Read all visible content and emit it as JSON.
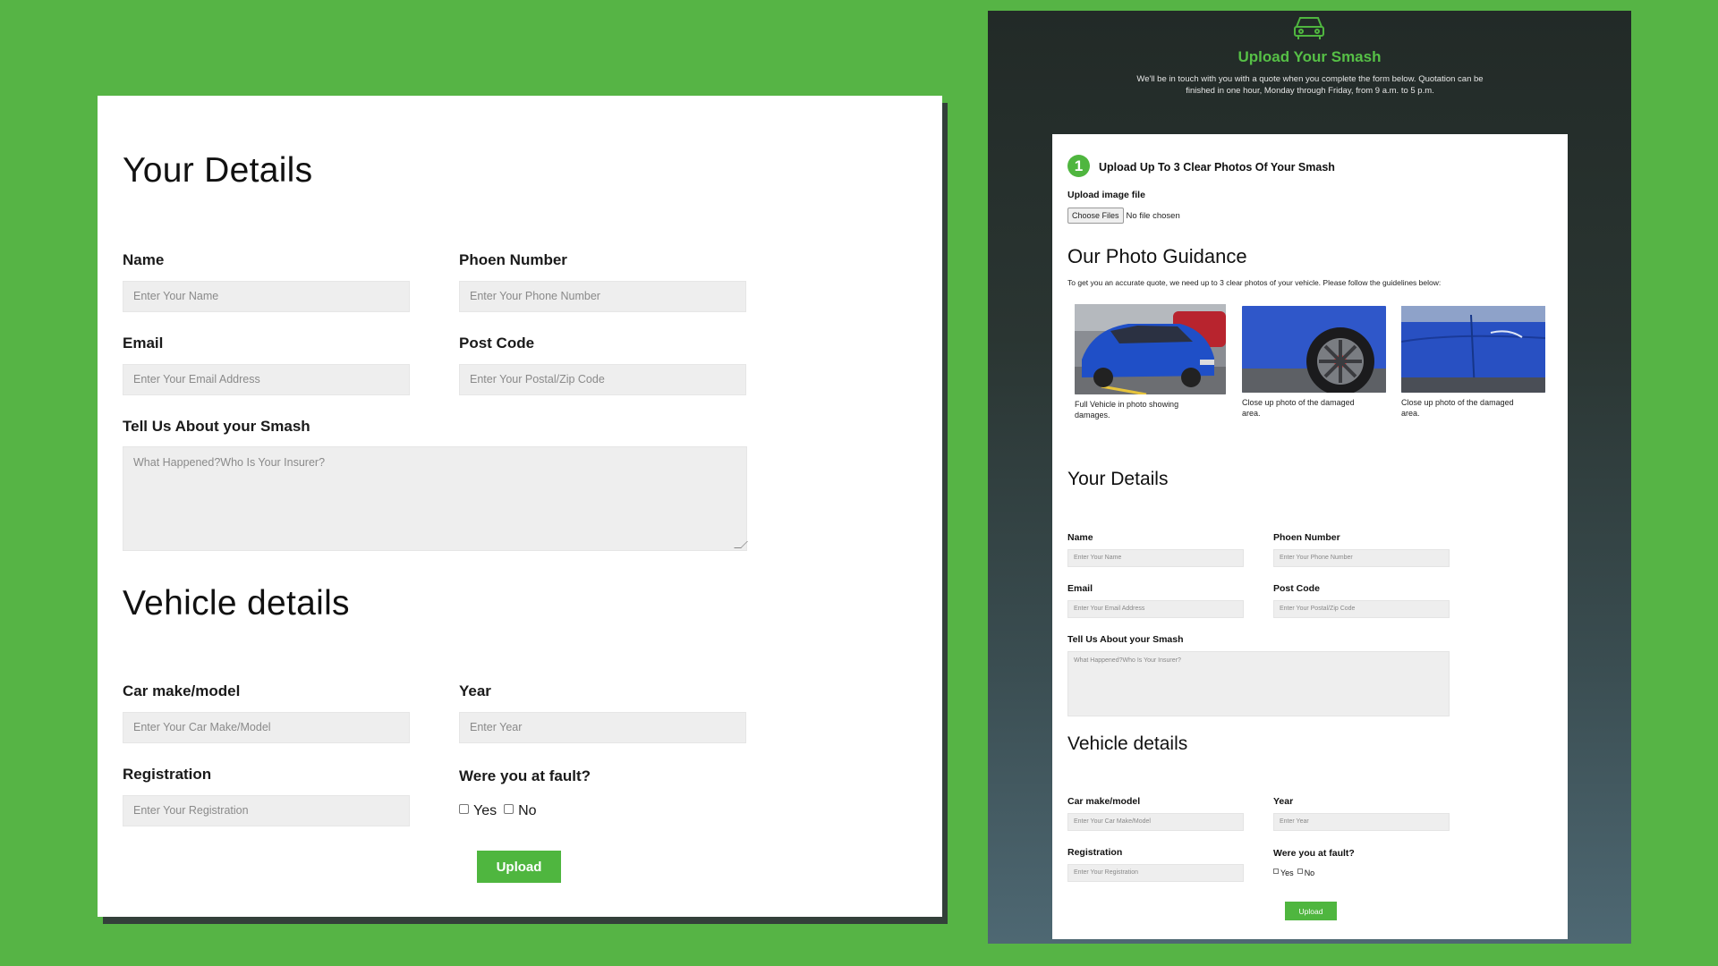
{
  "left_form": {
    "your_details_title": "Your Details",
    "name_label": "Name",
    "name_placeholder": "Enter Your Name",
    "phone_label": "Phoen Number",
    "phone_placeholder": "Enter Your Phone Number",
    "email_label": "Email",
    "email_placeholder": "Enter Your Email Address",
    "postcode_label": "Post Code",
    "postcode_placeholder": "Enter Your Postal/Zip Code",
    "smash_label": "Tell Us About your Smash",
    "smash_placeholder": "What Happened?Who Is Your Insurer?",
    "vehicle_title": "Vehicle details",
    "car_label": "Car make/model",
    "car_placeholder": "Enter Your Car Make/Model",
    "year_label": "Year",
    "year_placeholder": "Enter Year",
    "reg_label": "Registration",
    "reg_placeholder": "Enter Your Registration",
    "fault_label": "Were you at fault?",
    "fault_yes": "Yes",
    "fault_no": "No",
    "upload_button": "Upload"
  },
  "right_page": {
    "title": "Upload Your Smash",
    "subtitle": "We'll be in touch with you with a quote when you complete the form below. Quotation can be finished in one hour, Monday through Friday, from 9 a.m. to 5 p.m.",
    "step_number": "1",
    "step_text": "Upload Up To 3 Clear Photos Of Your Smash",
    "upload_file_label": "Upload image file",
    "choose_files": "Choose Files",
    "no_file": "No file chosen",
    "guidance_title": "Our Photo Guidance",
    "guidance_text": "To get you an accurate quote, we need up to 3 clear photos of your vehicle. Please follow the guidelines below:",
    "photo_captions": [
      "Full Vehicle in photo showing damages.",
      "Close up photo of the damaged area.",
      "Close up photo of the damaged area."
    ],
    "your_details_title": "Your Details",
    "name_label": "Name",
    "name_placeholder": "Enter Your Name",
    "phone_label": "Phoen Number",
    "phone_placeholder": "Enter Your Phone Number",
    "email_label": "Email",
    "email_placeholder": "Enter Your Email Address",
    "postcode_label": "Post Code",
    "postcode_placeholder": "Enter Your Postal/Zip Code",
    "smash_label": "Tell Us About your Smash",
    "smash_placeholder": "What Happened?Who Is Your Insurer?",
    "vehicle_title": "Vehicle details",
    "car_label": "Car make/model",
    "car_placeholder": "Enter Your Car Make/Model",
    "year_label": "Year",
    "year_placeholder": "Enter Year",
    "reg_label": "Registration",
    "reg_placeholder": "Enter Your Registration",
    "fault_label": "Were you at fault?",
    "fault_yes": "Yes",
    "fault_no": "No",
    "upload_button": "Upload"
  },
  "colors": {
    "background": "#56b445",
    "accent": "#4fb63f",
    "title_green": "#56c046"
  }
}
